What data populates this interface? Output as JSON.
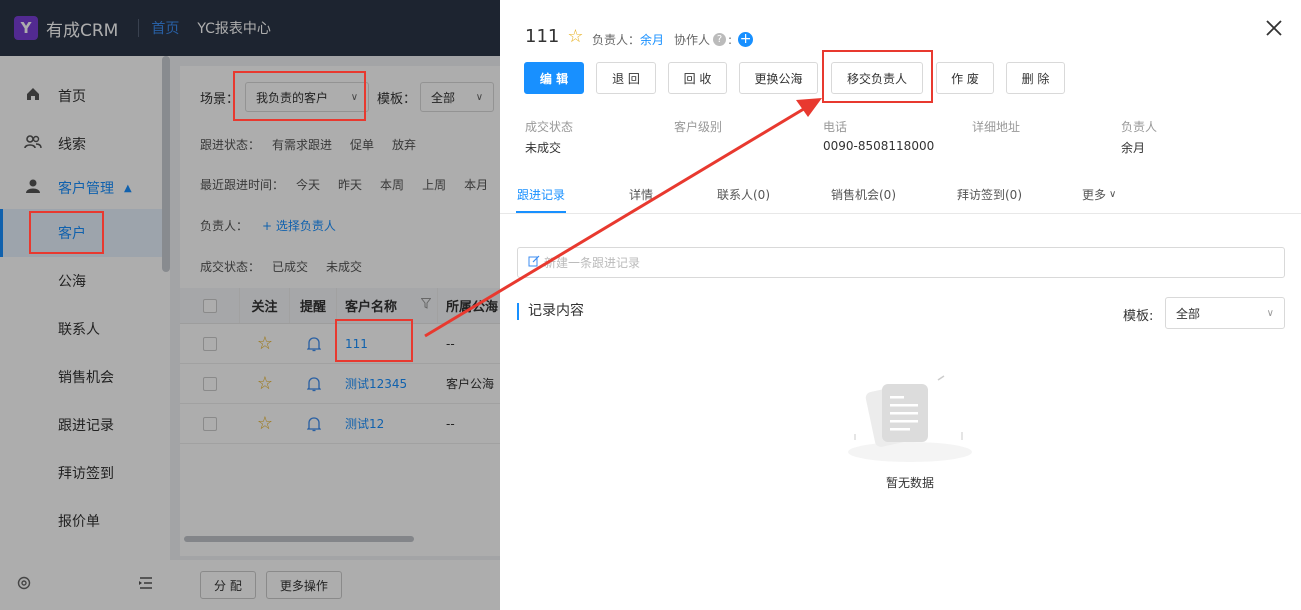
{
  "app": {
    "logo_letter": "Y",
    "name": "有成CRM"
  },
  "topnav": [
    {
      "label": "首页",
      "active": true
    },
    {
      "label": "YC报表中心",
      "active": false
    }
  ],
  "sidebar": {
    "items": [
      {
        "label": "首页",
        "icon": "home-icon"
      },
      {
        "label": "线索",
        "icon": "users-icon"
      },
      {
        "label": "客户管理",
        "icon": "user-icon"
      }
    ],
    "sub_items": [
      "客户",
      "公海",
      "联系人",
      "销售机会",
      "跟进记录",
      "拜访签到",
      "报价单"
    ],
    "active_sub": "客户"
  },
  "filters": {
    "scene_label": "场景：",
    "scene_value": "我负责的客户",
    "template_label": "模板：",
    "template_value": "全部",
    "follow_status_label": "跟进状态：",
    "follow_status_options": [
      "有需求跟进",
      "促单",
      "放弃"
    ],
    "recent_label": "最近跟进时间：",
    "recent_options": [
      "今天",
      "昨天",
      "本周",
      "上周",
      "本月"
    ],
    "owner_label": "负责人：",
    "owner_select": "+ 选择负责人",
    "deal_label": "成交状态：",
    "deal_options": [
      "已成交",
      "未成交"
    ]
  },
  "table": {
    "columns": [
      "关注",
      "提醒",
      "客户名称",
      "所属公海"
    ],
    "rows": [
      {
        "name": "111",
        "pool": "--"
      },
      {
        "name": "测试12345",
        "pool": "客户公海"
      },
      {
        "name": "测试12",
        "pool": "--"
      }
    ]
  },
  "footer": {
    "assign": "分 配",
    "more": "更多操作"
  },
  "detail": {
    "title": "111",
    "owner_label": "负责人：",
    "owner": "余月",
    "collab_label": "协作人",
    "buttons": [
      "编 辑",
      "退 回",
      "回 收",
      "更换公海",
      "移交负责人",
      "作 废",
      "删 除"
    ],
    "info": [
      {
        "key": "成交状态",
        "value": "未成交"
      },
      {
        "key": "客户级别",
        "value": ""
      },
      {
        "key": "电话",
        "value": "0090-8508118000"
      },
      {
        "key": "详细地址",
        "value": ""
      },
      {
        "key": "负责人",
        "value": "余月"
      }
    ],
    "tabs": [
      "跟进记录",
      "详情",
      "联系人(0)",
      "销售机会(0)",
      "拜访签到(0)",
      "更多"
    ],
    "new_record_placeholder": "新建一条跟进记录",
    "record_title": "记录内容",
    "template_label": "模板:",
    "template_value": "全部",
    "empty_text": "暂无数据"
  },
  "colors": {
    "primary": "#1890ff",
    "topbar": "#2b3648",
    "annotation": "#e8392f"
  }
}
